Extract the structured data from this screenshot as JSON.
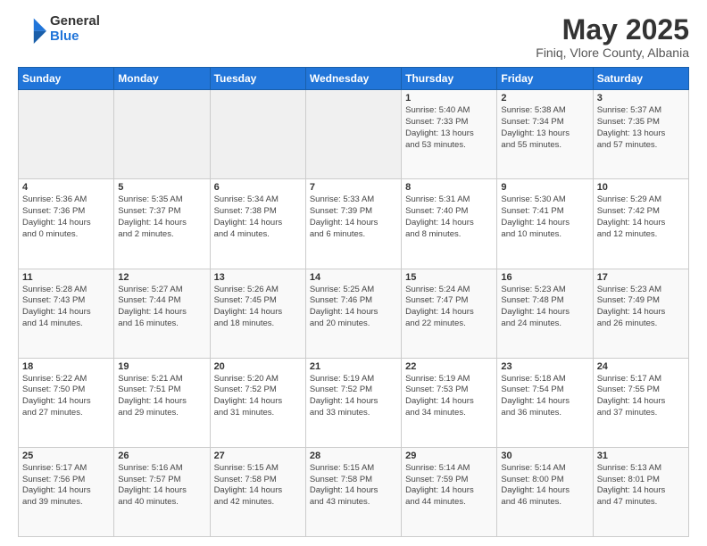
{
  "logo": {
    "general": "General",
    "blue": "Blue"
  },
  "title": {
    "main": "May 2025",
    "sub": "Finiq, Vlore County, Albania"
  },
  "calendar": {
    "headers": [
      "Sunday",
      "Monday",
      "Tuesday",
      "Wednesday",
      "Thursday",
      "Friday",
      "Saturday"
    ],
    "weeks": [
      [
        {
          "day": "",
          "info": ""
        },
        {
          "day": "",
          "info": ""
        },
        {
          "day": "",
          "info": ""
        },
        {
          "day": "",
          "info": ""
        },
        {
          "day": "1",
          "info": "Sunrise: 5:40 AM\nSunset: 7:33 PM\nDaylight: 13 hours\nand 53 minutes."
        },
        {
          "day": "2",
          "info": "Sunrise: 5:38 AM\nSunset: 7:34 PM\nDaylight: 13 hours\nand 55 minutes."
        },
        {
          "day": "3",
          "info": "Sunrise: 5:37 AM\nSunset: 7:35 PM\nDaylight: 13 hours\nand 57 minutes."
        }
      ],
      [
        {
          "day": "4",
          "info": "Sunrise: 5:36 AM\nSunset: 7:36 PM\nDaylight: 14 hours\nand 0 minutes."
        },
        {
          "day": "5",
          "info": "Sunrise: 5:35 AM\nSunset: 7:37 PM\nDaylight: 14 hours\nand 2 minutes."
        },
        {
          "day": "6",
          "info": "Sunrise: 5:34 AM\nSunset: 7:38 PM\nDaylight: 14 hours\nand 4 minutes."
        },
        {
          "day": "7",
          "info": "Sunrise: 5:33 AM\nSunset: 7:39 PM\nDaylight: 14 hours\nand 6 minutes."
        },
        {
          "day": "8",
          "info": "Sunrise: 5:31 AM\nSunset: 7:40 PM\nDaylight: 14 hours\nand 8 minutes."
        },
        {
          "day": "9",
          "info": "Sunrise: 5:30 AM\nSunset: 7:41 PM\nDaylight: 14 hours\nand 10 minutes."
        },
        {
          "day": "10",
          "info": "Sunrise: 5:29 AM\nSunset: 7:42 PM\nDaylight: 14 hours\nand 12 minutes."
        }
      ],
      [
        {
          "day": "11",
          "info": "Sunrise: 5:28 AM\nSunset: 7:43 PM\nDaylight: 14 hours\nand 14 minutes."
        },
        {
          "day": "12",
          "info": "Sunrise: 5:27 AM\nSunset: 7:44 PM\nDaylight: 14 hours\nand 16 minutes."
        },
        {
          "day": "13",
          "info": "Sunrise: 5:26 AM\nSunset: 7:45 PM\nDaylight: 14 hours\nand 18 minutes."
        },
        {
          "day": "14",
          "info": "Sunrise: 5:25 AM\nSunset: 7:46 PM\nDaylight: 14 hours\nand 20 minutes."
        },
        {
          "day": "15",
          "info": "Sunrise: 5:24 AM\nSunset: 7:47 PM\nDaylight: 14 hours\nand 22 minutes."
        },
        {
          "day": "16",
          "info": "Sunrise: 5:23 AM\nSunset: 7:48 PM\nDaylight: 14 hours\nand 24 minutes."
        },
        {
          "day": "17",
          "info": "Sunrise: 5:23 AM\nSunset: 7:49 PM\nDaylight: 14 hours\nand 26 minutes."
        }
      ],
      [
        {
          "day": "18",
          "info": "Sunrise: 5:22 AM\nSunset: 7:50 PM\nDaylight: 14 hours\nand 27 minutes."
        },
        {
          "day": "19",
          "info": "Sunrise: 5:21 AM\nSunset: 7:51 PM\nDaylight: 14 hours\nand 29 minutes."
        },
        {
          "day": "20",
          "info": "Sunrise: 5:20 AM\nSunset: 7:52 PM\nDaylight: 14 hours\nand 31 minutes."
        },
        {
          "day": "21",
          "info": "Sunrise: 5:19 AM\nSunset: 7:52 PM\nDaylight: 14 hours\nand 33 minutes."
        },
        {
          "day": "22",
          "info": "Sunrise: 5:19 AM\nSunset: 7:53 PM\nDaylight: 14 hours\nand 34 minutes."
        },
        {
          "day": "23",
          "info": "Sunrise: 5:18 AM\nSunset: 7:54 PM\nDaylight: 14 hours\nand 36 minutes."
        },
        {
          "day": "24",
          "info": "Sunrise: 5:17 AM\nSunset: 7:55 PM\nDaylight: 14 hours\nand 37 minutes."
        }
      ],
      [
        {
          "day": "25",
          "info": "Sunrise: 5:17 AM\nSunset: 7:56 PM\nDaylight: 14 hours\nand 39 minutes."
        },
        {
          "day": "26",
          "info": "Sunrise: 5:16 AM\nSunset: 7:57 PM\nDaylight: 14 hours\nand 40 minutes."
        },
        {
          "day": "27",
          "info": "Sunrise: 5:15 AM\nSunset: 7:58 PM\nDaylight: 14 hours\nand 42 minutes."
        },
        {
          "day": "28",
          "info": "Sunrise: 5:15 AM\nSunset: 7:58 PM\nDaylight: 14 hours\nand 43 minutes."
        },
        {
          "day": "29",
          "info": "Sunrise: 5:14 AM\nSunset: 7:59 PM\nDaylight: 14 hours\nand 44 minutes."
        },
        {
          "day": "30",
          "info": "Sunrise: 5:14 AM\nSunset: 8:00 PM\nDaylight: 14 hours\nand 46 minutes."
        },
        {
          "day": "31",
          "info": "Sunrise: 5:13 AM\nSunset: 8:01 PM\nDaylight: 14 hours\nand 47 minutes."
        }
      ]
    ]
  }
}
